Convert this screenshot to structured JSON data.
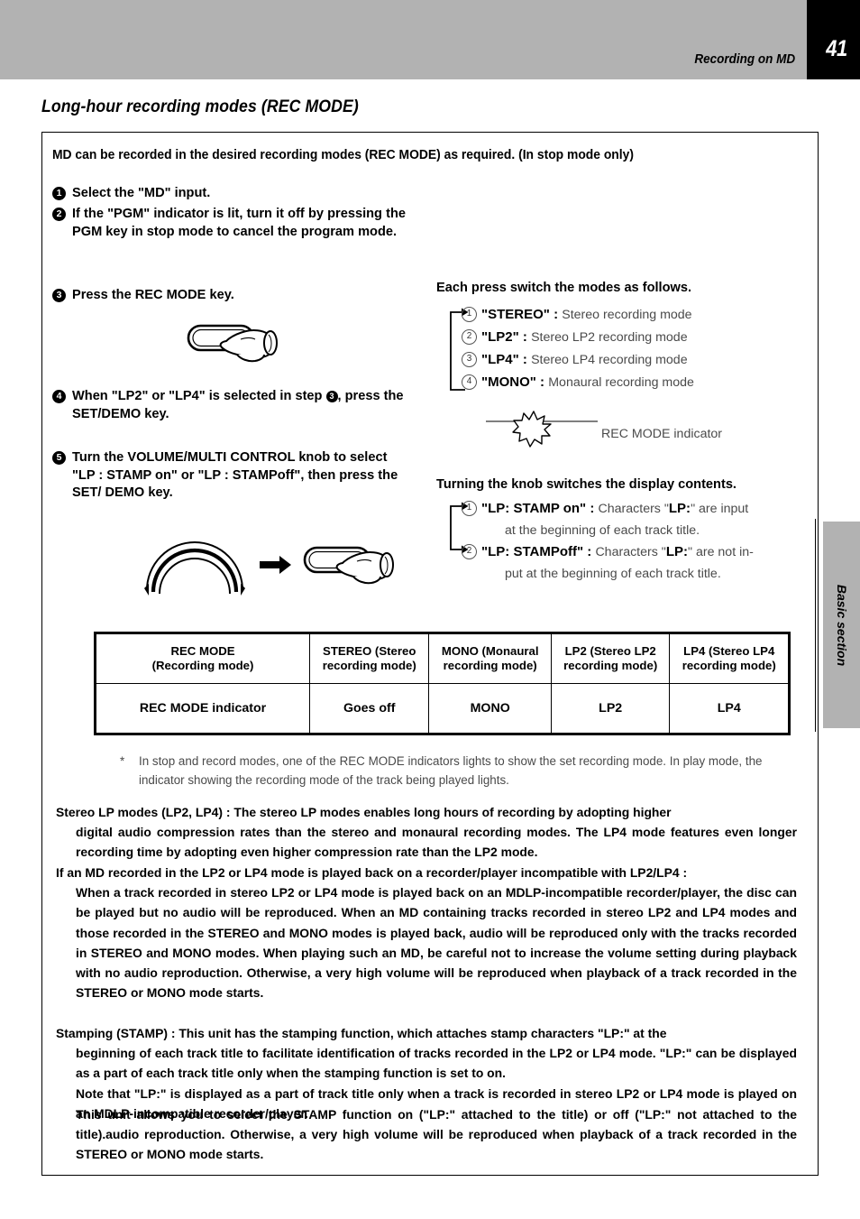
{
  "header": {
    "title": "Recording on MD",
    "page_number": "41",
    "band_color": "#b2b2b2",
    "page_box_color": "#000000"
  },
  "side_tab": {
    "label": "Basic section"
  },
  "section": {
    "heading": "Long-hour recording modes (REC MODE)",
    "lede": "MD can be recorded in the desired recording modes (REC MODE) as required. (In stop mode only)"
  },
  "steps": [
    {
      "num": "1",
      "text": "Select the \"MD\" input."
    },
    {
      "num": "2",
      "text": "If the \"PGM\" indicator is lit, turn it off by pressing the PGM key in stop mode to cancel the program mode."
    },
    {
      "num": "3",
      "text": "Press the REC MODE key."
    },
    {
      "num": "4",
      "text_before": "When \"LP2\" or \"LP4\" is selected in step ",
      "ref": "3",
      "text_after": ", press the SET/DEMO key."
    },
    {
      "num": "5",
      "text": "Turn the VOLUME/MULTI CONTROL knob to select \"LP : STAMP on\" or \"LP : STAMPoff\", then press the SET/ DEMO key."
    }
  ],
  "mode_cycle": {
    "title": "Each press switch the modes as follows.",
    "items": [
      {
        "index": "1",
        "name": "\"STEREO\"",
        "sep": " : ",
        "desc": "Stereo recording mode"
      },
      {
        "index": "2",
        "name": "\"LP2\"",
        "sep": " : ",
        "desc": "Stereo LP2 recording mode"
      },
      {
        "index": "3",
        "name": "\"LP4\"",
        "sep": " : ",
        "desc": "Stereo LP4 recording mode"
      },
      {
        "index": "4",
        "name": "\"MONO\"",
        "sep": " : ",
        "desc": "Monaural recording mode"
      }
    ],
    "indicator_label": "REC MODE indicator"
  },
  "stamp_cycle": {
    "title": "Turning the knob switches the display contents.",
    "items": [
      {
        "index": "1",
        "name": "\"LP: STAMP on\"",
        "sep": " : ",
        "desc_1": "Characters \"",
        "desc_bold": "LP:",
        "desc_2": "\" are input",
        "line2": "at the beginning of each track title."
      },
      {
        "index": "2",
        "name": "\"LP: STAMPoff\"",
        "sep": " : ",
        "desc_1": "Characters \"",
        "desc_bold": "LP:",
        "desc_2": "\" are not in-",
        "line2": "put at the beginning of each track title."
      }
    ]
  },
  "table": {
    "rows": [
      {
        "cells": [
          "REC MODE\n(Recording mode)",
          "STEREO (Stereo recording mode)",
          "MONO (Monaural recording mode)",
          "LP2 (Stereo LP2 recording mode)",
          "LP4 (Stereo LP4 recording mode)"
        ]
      },
      {
        "cells": [
          "REC MODE indicator",
          "Goes off",
          "MONO",
          "LP2",
          "LP4"
        ]
      }
    ]
  },
  "footnote": {
    "marker": "*",
    "text": "In stop and record modes, one of the REC MODE indicators lights to show the set recording mode. In play mode, the indicator showing the recording mode of the track being played lights."
  },
  "paragraphs": [
    {
      "id": "stereo-lp-modes",
      "line1": "Stereo LP modes (LP2, LP4) : The stereo LP modes enables long hours of recording by adopting higher",
      "rest": "digital audio compression rates than the stereo and monaural recording modes. The LP4 mode features even longer recording time by adopting even higher compression rate than the LP2 mode."
    },
    {
      "id": "incompatible-playback",
      "line1": "If an MD recorded in the LP2 or LP4 mode is played back on a recorder/player incompatible with LP2/LP4 :",
      "rest": "When a track recorded in stereo LP2 or LP4 mode is played back on an MDLP-incompatible recorder/player, the disc can be played but no audio will be reproduced. When an MD containing tracks recorded in stereo LP2 and LP4 modes and those recorded in the STEREO and MONO modes is played back, audio will be reproduced only with the tracks recorded in STEREO and MONO modes. When playing such an MD, be careful not to increase the volume setting during playback with no audio reproduction. Otherwise, a very high volume will be reproduced when playback of a track recorded in the STEREO or MONO mode starts."
    },
    {
      "id": "stamping",
      "line1": "Stamping (STAMP) : This unit has the stamping function, which attaches stamp characters \"LP:\" at the",
      "rest": "beginning of each track title to facilitate identification of tracks recorded in the LP2 or LP4 mode. \"LP:\" can be displayed as a part of each track title only when the stamping function is set to on.",
      "rest2": "Note that \"LP:\" is displayed as a part of track title only when a track is recorded in stereo LP2 or LP4 mode is played on an MDLP-incompatible recorder/player."
    },
    {
      "id": "stamp-select",
      "line1": "This unit allows you to select the STAMP function on (\"LP:\" attached to the title) or off (\"LP:\" not attached to the title).audio reproduction. Otherwise, a very high volume will be reproduced when playback of a track recorded in the STEREO or MONO mode starts."
    }
  ]
}
